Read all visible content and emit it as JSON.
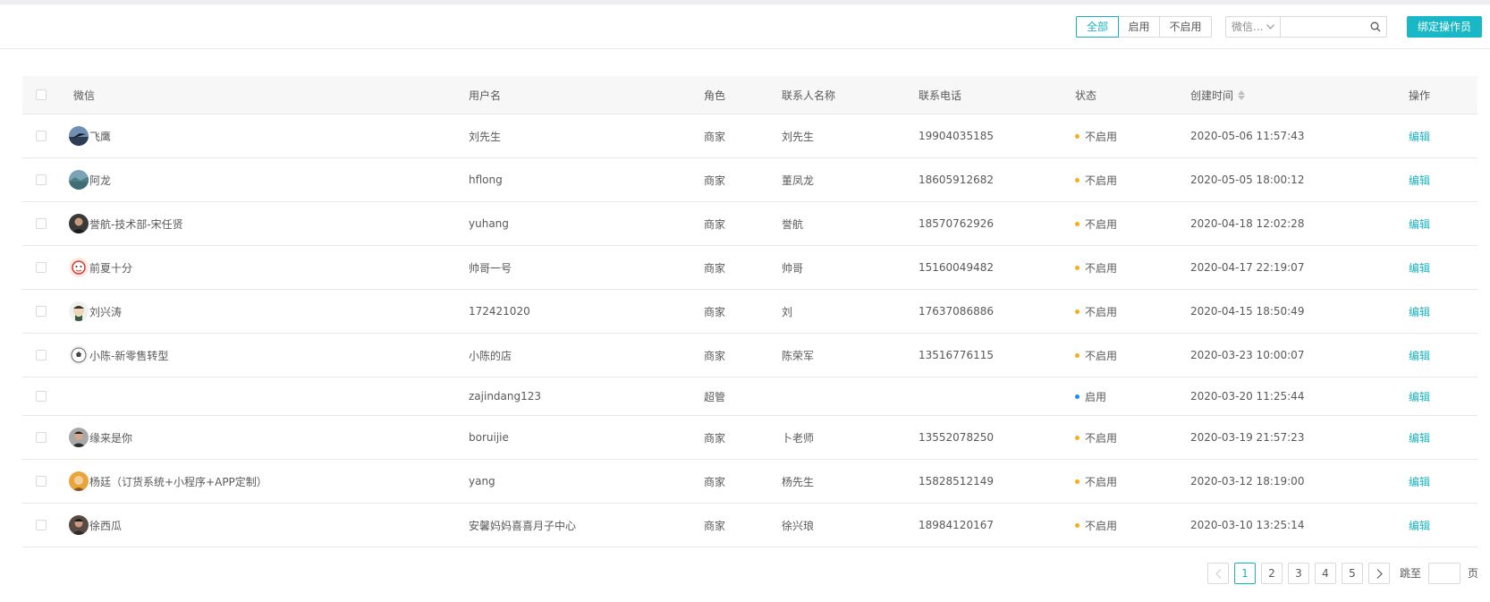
{
  "filter": {
    "all": "全部",
    "enabled": "启用",
    "disabled": "不启用",
    "active": "all"
  },
  "search": {
    "type_label": "微信...",
    "value": "",
    "placeholder": ""
  },
  "bind_button": "绑定操作员",
  "columns": [
    "微信",
    "用户名",
    "角色",
    "联系人名称",
    "联系电话",
    "状态",
    "创建时间",
    "操作"
  ],
  "colors": {
    "accent": "#17b3c1",
    "disabled_dot": "#faad14",
    "enabled_dot": "#1890ff"
  },
  "rows": [
    {
      "wechat": "飞鹰",
      "username": "刘先生",
      "role": "商家",
      "contact": "刘先生",
      "phone": "19904035185",
      "status": "不启用",
      "created": "2020-05-06 11:57:43",
      "action": "编辑",
      "avatar": "bird"
    },
    {
      "wechat": "阿龙",
      "username": "hflong",
      "role": "商家",
      "contact": "董凤龙",
      "phone": "18605912682",
      "status": "不启用",
      "created": "2020-05-05 18:00:12",
      "action": "编辑",
      "avatar": "landscape"
    },
    {
      "wechat": "誉航-技术部-宋任贤",
      "username": "yuhang",
      "role": "商家",
      "contact": "誉航",
      "phone": "18570762926",
      "status": "不启用",
      "created": "2020-04-18 12:02:28",
      "action": "编辑",
      "avatar": "person-dark"
    },
    {
      "wechat": "前夏十分",
      "username": "帅哥一号",
      "role": "商家",
      "contact": "帅哥",
      "phone": "15160049482",
      "status": "不启用",
      "created": "2020-04-17 22:19:07",
      "action": "编辑",
      "avatar": "cartoon-red"
    },
    {
      "wechat": "刘兴涛",
      "username": "172421020",
      "role": "商家",
      "contact": "刘",
      "phone": "17637086886",
      "status": "不启用",
      "created": "2020-04-15 18:50:49",
      "action": "编辑",
      "avatar": "cartoon-face"
    },
    {
      "wechat": "小陈-新零售转型",
      "username": "小陈的店",
      "role": "商家",
      "contact": "陈荣军",
      "phone": "13516776115",
      "status": "不启用",
      "created": "2020-03-23 10:00:07",
      "action": "编辑",
      "avatar": "ball"
    },
    {
      "wechat": "",
      "username": "zajindang123",
      "role": "超管",
      "contact": "",
      "phone": "",
      "status": "启用",
      "created": "2020-03-20 11:25:44",
      "action": "编辑",
      "avatar": ""
    },
    {
      "wechat": "缘来是你",
      "username": "boruijie",
      "role": "商家",
      "contact": "卜老师",
      "phone": "13552078250",
      "status": "不启用",
      "created": "2020-03-19 21:57:23",
      "action": "编辑",
      "avatar": "person-photo"
    },
    {
      "wechat": "杨廷（订货系统+小程序+APP定制）",
      "username": "yang",
      "role": "商家",
      "contact": "杨先生",
      "phone": "15828512149",
      "status": "不启用",
      "created": "2020-03-12 18:19:00",
      "action": "编辑",
      "avatar": "warm"
    },
    {
      "wechat": "徐西瓜",
      "username": "安馨妈妈喜喜月子中心",
      "role": "商家",
      "contact": "徐兴琅",
      "phone": "18984120167",
      "status": "不启用",
      "created": "2020-03-10 13:25:14",
      "action": "编辑",
      "avatar": "person-dark2"
    }
  ],
  "pagination": {
    "pages": [
      "1",
      "2",
      "3",
      "4",
      "5"
    ],
    "current": "1",
    "jump_label": "跳至",
    "page_suffix": "页"
  }
}
